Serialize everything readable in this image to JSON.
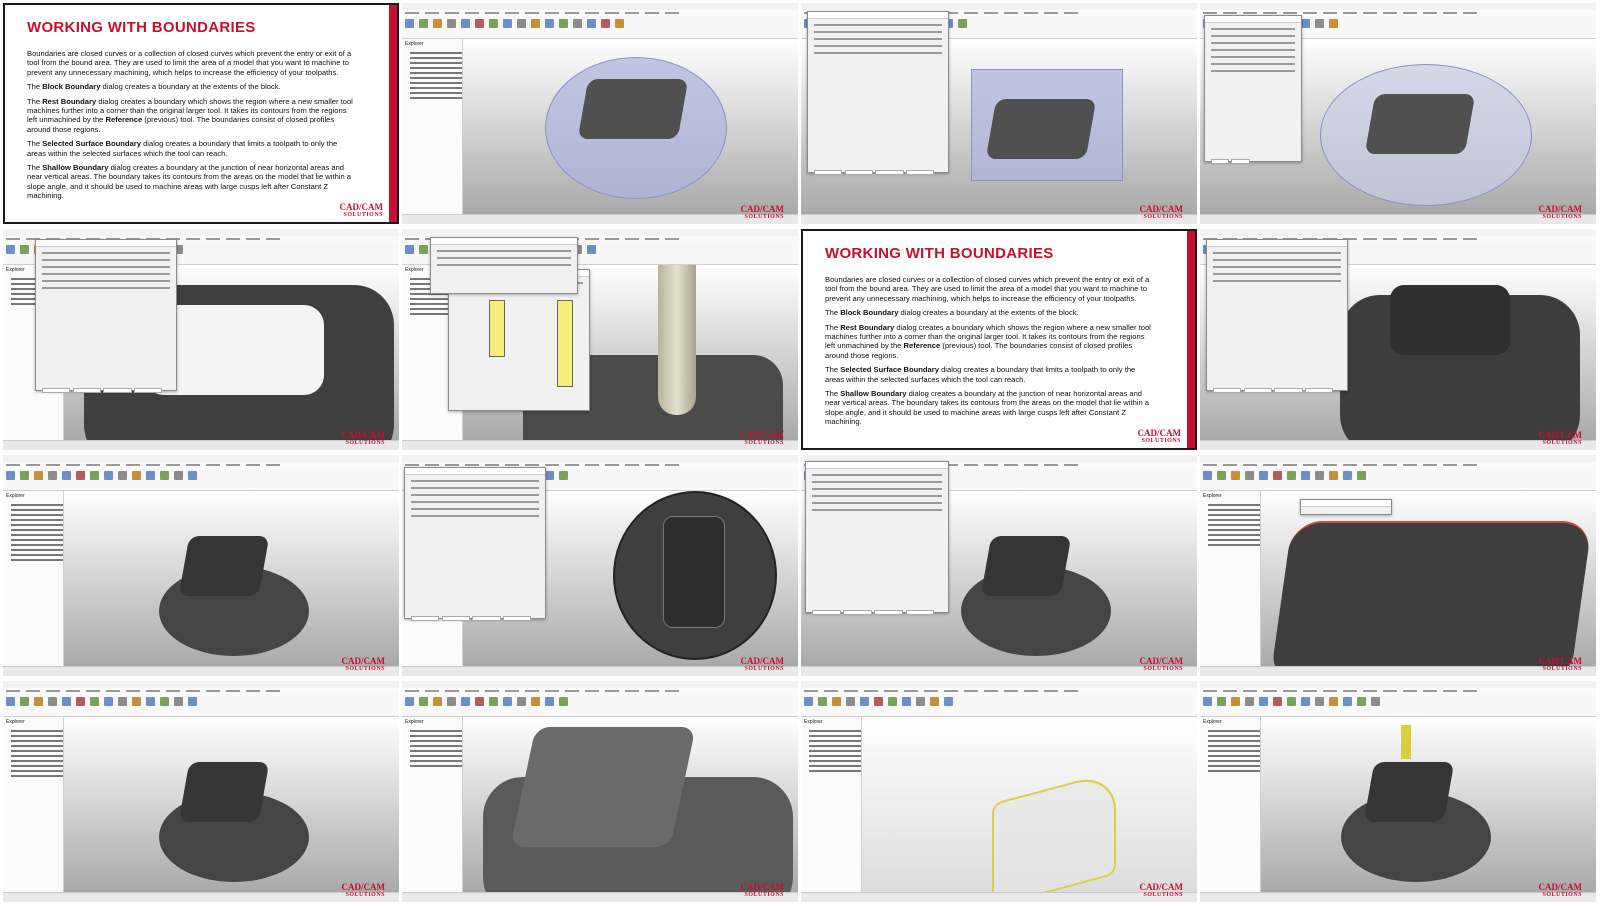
{
  "slide": {
    "heading": "WORKING WITH BOUNDARIES",
    "intro": "Boundaries are closed curves or a collection of closed curves which prevent the entry or exit of a tool from the bound area. They are used to limit the area of a model that you want to machine to prevent any unnecessary machining, which helps to increase the efficiency of your toolpaths.",
    "block_term": "Block Boundary",
    "block_text": " dialog creates a boundary at the extents of the block.",
    "the": "The ",
    "rest_term": "Rest Boundary",
    "rest_text_1": " dialog creates a boundary which shows the region where a new smaller tool machines further into a corner than the original larger tool. It takes its contours from the regions left unmachined by the ",
    "rest_ref": "Reference",
    "rest_text_2": " (previous) tool. The boundaries consist of closed profiles around those regions.",
    "selected_term": "Selected Surface Boundary",
    "selected_text": " dialog creates a boundary that limits a toolpath to only the areas within the selected surfaces which the tool can reach.",
    "shallow_term": "Shallow Boundary",
    "shallow_text": " dialog creates a boundary at the junction of near horizontal areas and near vertical areas. The boundary takes its contours from the areas on the model that lie within a slope angle, and it should be used to machine areas with large cusps left after Constant Z machining."
  },
  "logo": {
    "line1": "CAD/CAM",
    "line2": "SOLUTIONS"
  },
  "app": {
    "explorer_label": "Explorer"
  },
  "colors": {
    "accent_red": "#c8102e",
    "model_gray": "#4a4a4a",
    "block_blue": "#aeb6dc",
    "highlight_yellow": "#e6e04a"
  }
}
